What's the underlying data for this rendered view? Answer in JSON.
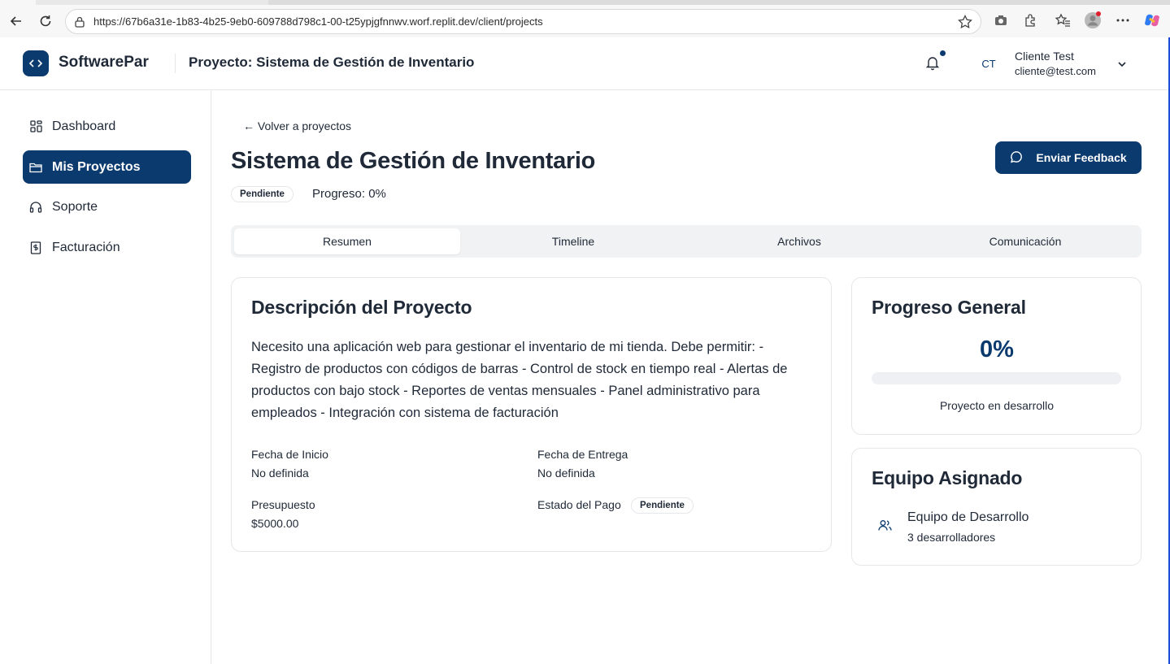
{
  "browser": {
    "url": "https://67b6a31e-1b83-4b25-9eb0-609788d798c1-00-t25ypjgfnnwv.worf.replit.dev/client/projects"
  },
  "header": {
    "brand": "SoftwarePar",
    "title": "Proyecto: Sistema de Gestión de Inventario",
    "user_initials": "CT",
    "user_name": "Cliente Test",
    "user_email": "cliente@test.com"
  },
  "sidebar": {
    "items": [
      {
        "label": "Dashboard",
        "icon": "grid-icon"
      },
      {
        "label": "Mis Proyectos",
        "icon": "folder-icon",
        "active": true
      },
      {
        "label": "Soporte",
        "icon": "headphones-icon"
      },
      {
        "label": "Facturación",
        "icon": "receipt-icon"
      }
    ]
  },
  "main": {
    "back_label": "← Volver a proyectos",
    "title": "Sistema de Gestión de Inventario",
    "status_badge": "Pendiente",
    "progress_label": "Progreso: 0%",
    "feedback_label": "Enviar Feedback",
    "tabs": [
      {
        "label": "Resumen",
        "active": true
      },
      {
        "label": "Timeline"
      },
      {
        "label": "Archivos"
      },
      {
        "label": "Comunicación"
      }
    ]
  },
  "description_card": {
    "title": "Descripción del Proyecto",
    "text": "Necesito una aplicación web para gestionar el inventario de mi tienda. Debe permitir: - Registro de productos con códigos de barras - Control de stock en tiempo real - Alertas de productos con bajo stock - Reportes de ventas mensuales - Panel administrativo para empleados - Integración con sistema de facturación",
    "start_label": "Fecha de Inicio",
    "start_value": "No definida",
    "delivery_label": "Fecha de Entrega",
    "delivery_value": "No definida",
    "budget_label": "Presupuesto",
    "budget_value": "$5000.00",
    "payment_label": "Estado del Pago",
    "payment_badge": "Pendiente"
  },
  "progress_card": {
    "title": "Progreso General",
    "percent_label": "0%",
    "progress_fraction": 0,
    "caption": "Proyecto en desarrollo"
  },
  "team_card": {
    "title": "Equipo Asignado",
    "team_name": "Equipo de Desarrollo",
    "team_count": "3 desarrolladores"
  },
  "colors": {
    "primary": "#0b3a6e",
    "border": "#e5e7eb",
    "tab_bg": "#f1f2f4"
  }
}
